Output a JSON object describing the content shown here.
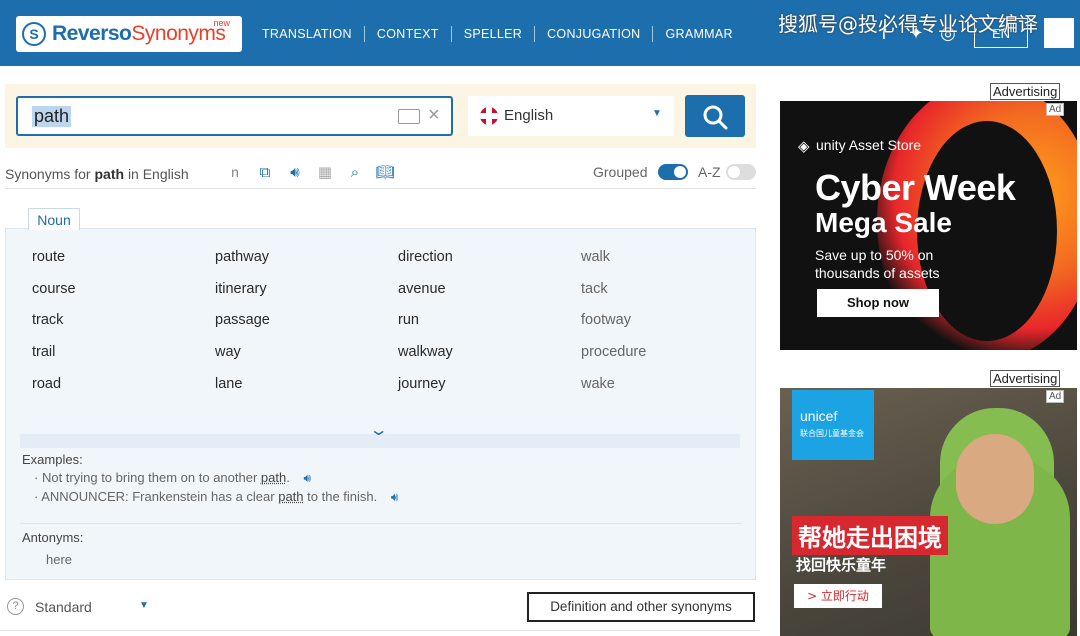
{
  "header": {
    "logo_part1": "Reverso",
    "logo_part2": "Synonyms",
    "logo_badge": "new",
    "nav": [
      "TRANSLATION",
      "CONTEXT",
      "SPELLER",
      "CONJUGATION",
      "GRAMMAR"
    ],
    "lang_button": "EN",
    "watermark": "搜狐号@投必得专业论文编译"
  },
  "search": {
    "query": "path",
    "language": "English"
  },
  "results": {
    "prefix": "Synonyms for",
    "word": "path",
    "suffix": "in English",
    "n_label": "n",
    "grouped_label": "Grouped",
    "az_label": "A-Z",
    "pos_tab": "Noun",
    "columns": [
      [
        "route",
        "course",
        "track",
        "trail",
        "road"
      ],
      [
        "pathway",
        "itinerary",
        "passage",
        "way",
        "lane"
      ],
      [
        "direction",
        "avenue",
        "run",
        "walkway",
        "journey"
      ],
      [
        "walk",
        "tack",
        "footway",
        "procedure",
        "wake"
      ]
    ],
    "examples_title": "Examples:",
    "examples": [
      {
        "before": "Not trying to bring them on to another ",
        "word": "path",
        "after": "."
      },
      {
        "before": "ANNOUNCER: Frankenstein has a clear ",
        "word": "path",
        "after": " to the finish."
      }
    ],
    "antonyms_title": "Antonyms:",
    "antonyms": [
      "here"
    ]
  },
  "footer": {
    "mode": "Standard",
    "definition_button": "Definition and other synonyms"
  },
  "ads": {
    "label": "Advertising",
    "badge": "Ad",
    "ad1": {
      "brand": "unity Asset Store",
      "headline1": "Cyber Week",
      "headline2": "Mega Sale",
      "body": "Save up to 50% on thousands of assets",
      "cta": "Shop now"
    },
    "ad2": {
      "brand": "unicef",
      "brand_sub": "联合国儿童基金会",
      "headline": "帮她走出困境",
      "sub": "找回快乐童年",
      "cta": "> 立即行动"
    }
  },
  "colors": {
    "brand_blue": "#1d6eac",
    "brand_red": "#e6412b"
  }
}
